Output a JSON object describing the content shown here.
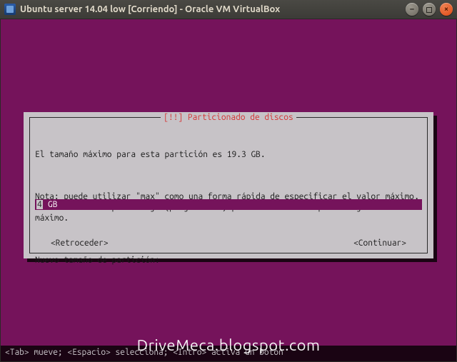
{
  "window": {
    "title": "Ubuntu server 14.04 low [Corriendo] - Oracle VM VirtualBox"
  },
  "dialog": {
    "title": "[!!] Particionado de discos",
    "body1": "El tamaño máximo para esta partición es 19.3 GB.",
    "body2": "Nota: puede utilizar \"max\" como una forma rápida de especificar el valor máximo, o introducir un porcentaje (p.ej. \"20%\") para utilizar ese porcentaje del tamaño máximo.",
    "body3": "Nuevo tamaño de partición:",
    "input_leading": "4",
    "input_trail": " GB",
    "back": "<Retroceder>",
    "continue": "<Continuar>"
  },
  "statusbar": "<Tab> mueve; <Espacio> selecciona; <Intro> activa un botón",
  "watermark": "DriveMeca.blogspot.com"
}
